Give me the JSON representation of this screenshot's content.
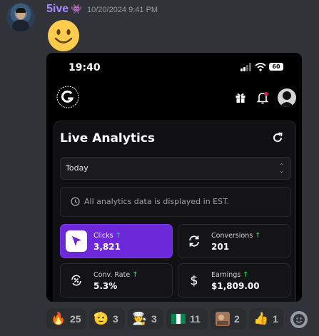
{
  "message": {
    "username": "5ive",
    "badge": "👾",
    "timestamp": "10/20/2024 9:41 PM",
    "emoji": "slightly-smiling-face"
  },
  "phone": {
    "status_time": "19:40",
    "battery": "60",
    "panel_title": "Live Analytics",
    "range_select": "Today",
    "notice": "All analytics data is displayed in EST.",
    "stats": [
      {
        "label": "Clicks",
        "value": "3,821",
        "icon": "cursor-arrow-icon",
        "trend": "↑"
      },
      {
        "label": "Conversions",
        "value": "201",
        "icon": "refresh-cycle-icon",
        "trend": "↑"
      },
      {
        "label": "Conv. Rate",
        "value": "5.3%",
        "icon": "percent-cycle-icon",
        "trend": "↑"
      },
      {
        "label": "Earnings",
        "value": "$1,809.00",
        "icon": "dollar-icon",
        "trend": "↑"
      }
    ],
    "accent_color": "#6d28d9",
    "trend_color": "#22c55e"
  },
  "reactions": [
    {
      "emoji": "🔥",
      "count": "25",
      "name": "fire"
    },
    {
      "emoji": "🫡",
      "count": "3",
      "name": "salute"
    },
    {
      "emoji": "🧑‍🍳",
      "count": "3",
      "name": "cook"
    },
    {
      "emoji": "🇳🇬",
      "count": "11",
      "name": "flag-nigeria"
    },
    {
      "emoji": "🖼",
      "count": "2",
      "name": "custom-image"
    },
    {
      "emoji": "👍",
      "count": "1",
      "name": "thumbs-up"
    }
  ]
}
